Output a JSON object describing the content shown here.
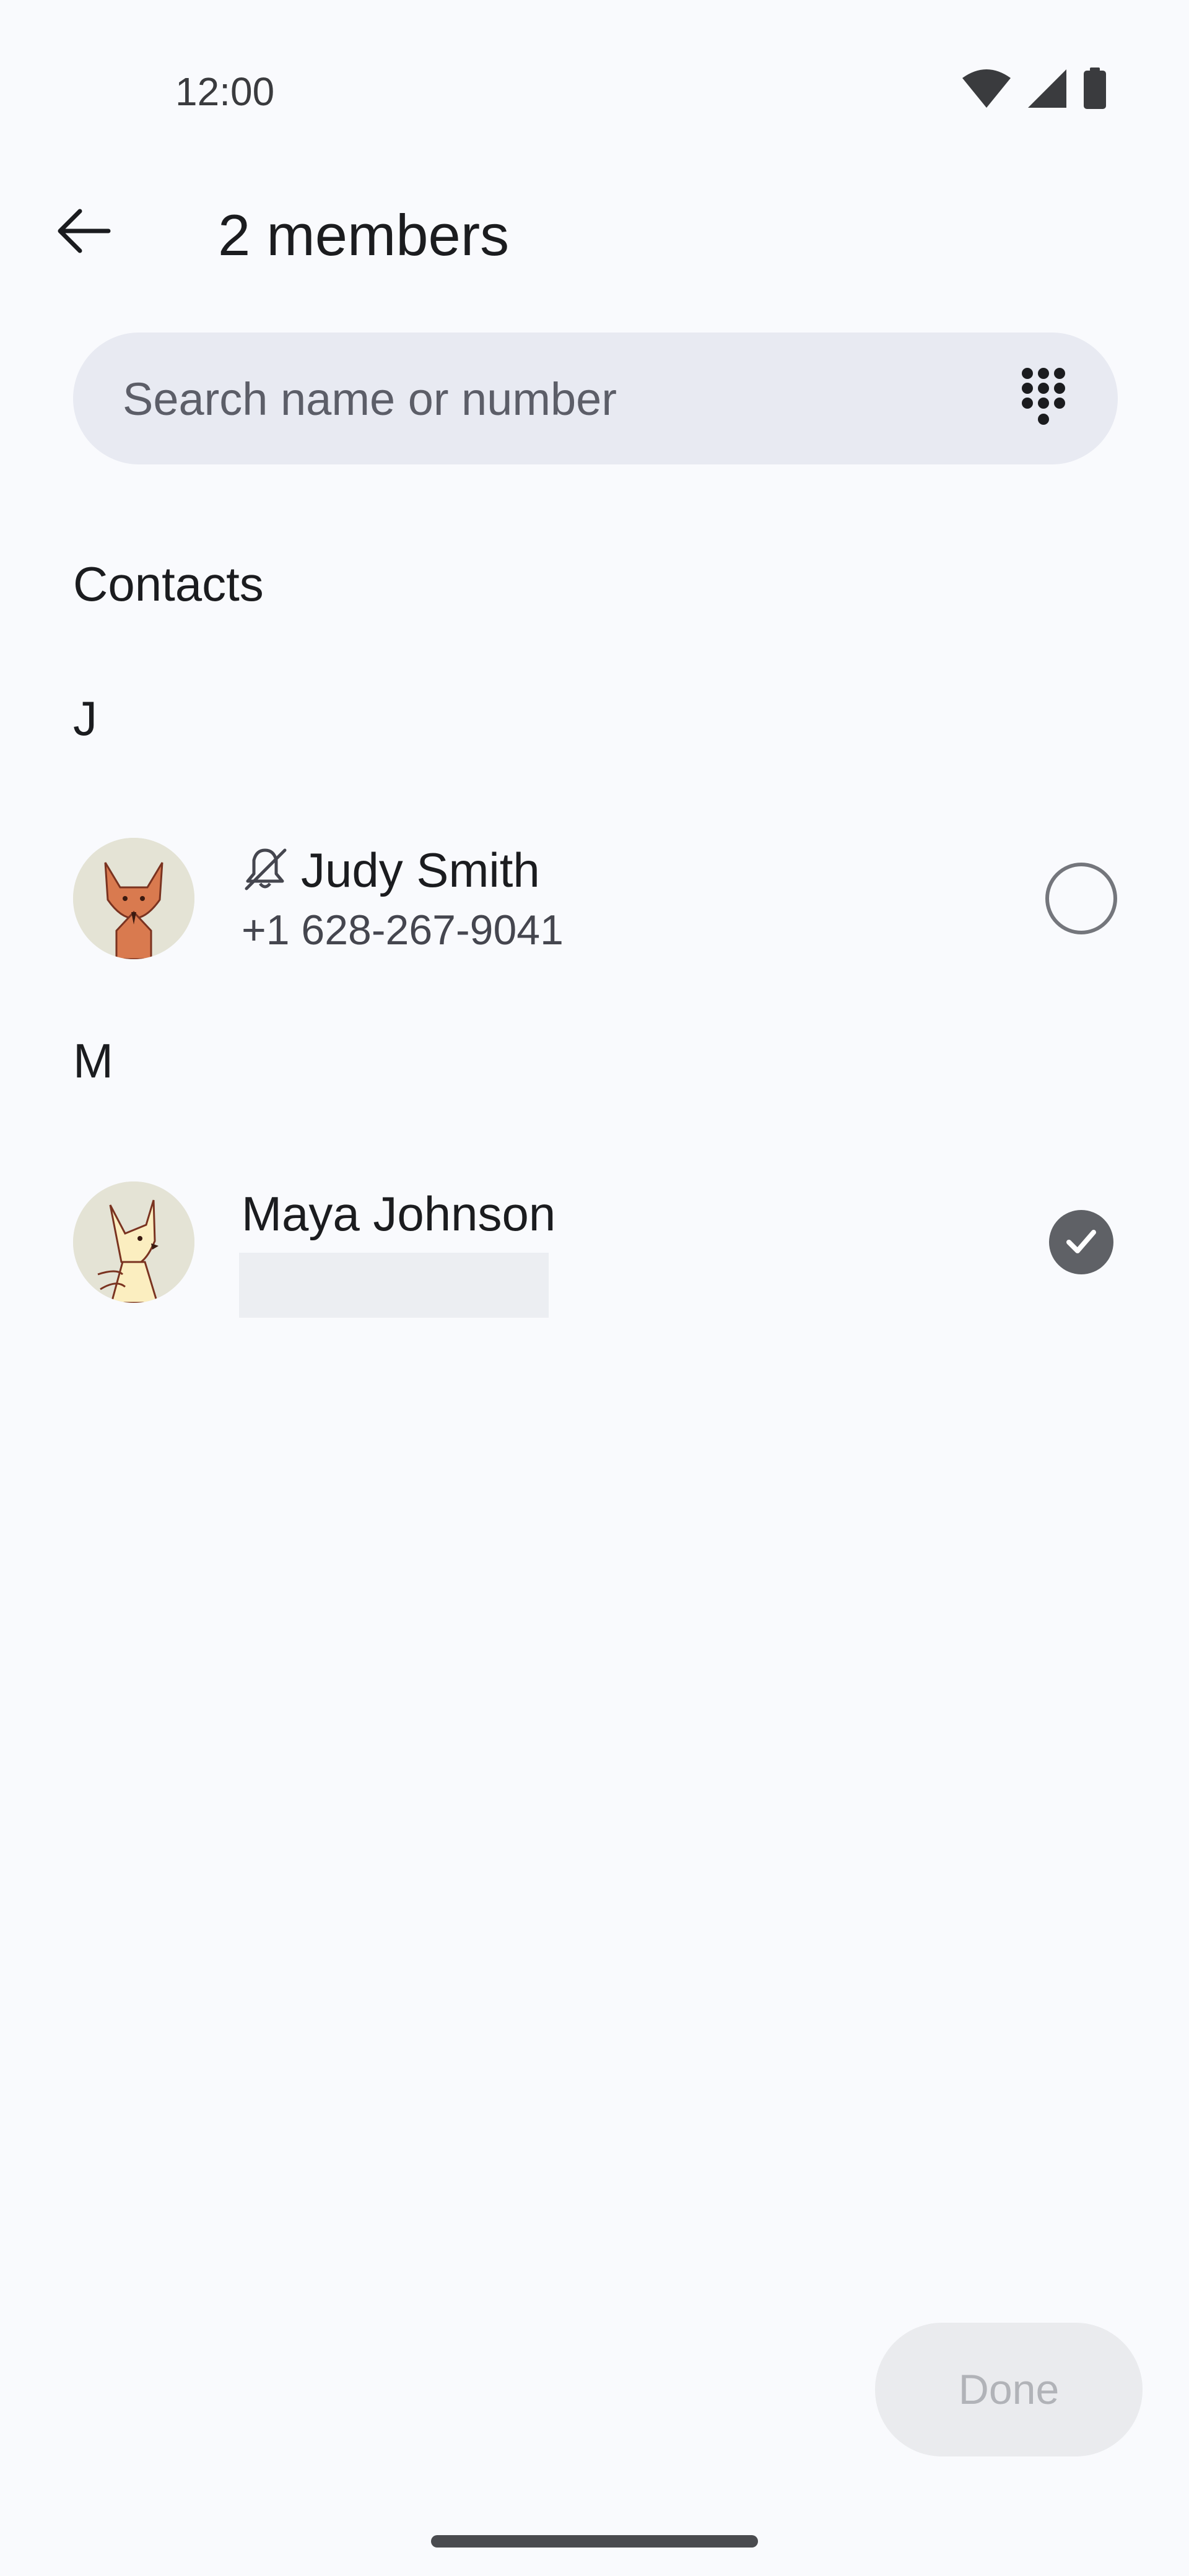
{
  "status_bar": {
    "time": "12:00",
    "icons": [
      "wifi-icon",
      "cellular-signal-icon",
      "battery-icon"
    ]
  },
  "header": {
    "title": "2 members",
    "back_icon": "arrow-back-icon"
  },
  "search": {
    "placeholder": "Search name or number",
    "dialpad_icon": "dialpad-icon"
  },
  "section_title": "Contacts",
  "groups": [
    {
      "letter": "J",
      "contacts": [
        {
          "name": "Judy Smith",
          "phone": "+1 628-267-9041",
          "muted_icon": "notifications-off-icon",
          "avatar": "fox-avatar",
          "selected": false
        }
      ]
    },
    {
      "letter": "M",
      "contacts": [
        {
          "name": "Maya Johnson",
          "phone_redacted": true,
          "avatar": "fox-avatar-light",
          "selected": true
        }
      ]
    }
  ],
  "actions": {
    "done_label": "Done",
    "done_enabled": false
  },
  "colors": {
    "background": "#f9fafd",
    "search_bg": "#e8eaf2",
    "selected_check": "#5f6166",
    "done_bg": "#eaebee",
    "done_text": "#b1b3b8"
  }
}
